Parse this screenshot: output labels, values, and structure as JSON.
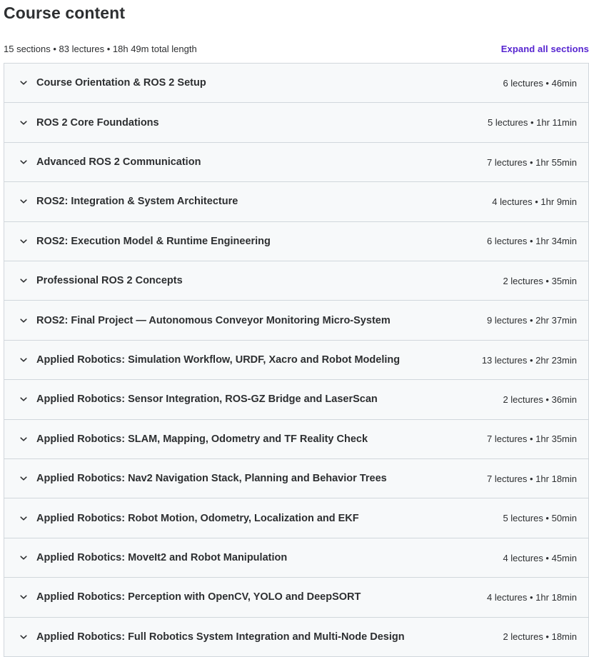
{
  "header": {
    "title": "Course content",
    "summary": "15 sections • 83 lectures • 18h 49m total length",
    "expand_label": "Expand all sections"
  },
  "colors": {
    "accent": "#5624d0",
    "text": "#2d2f31",
    "row_bg": "#f7f9fa",
    "border": "#d1d7dc"
  },
  "sections": [
    {
      "title": "Course Orientation & ROS 2 Setup",
      "meta": "6 lectures • 46min",
      "icon": "chevron-down-icon"
    },
    {
      "title": "ROS 2 Core Foundations",
      "meta": "5 lectures • 1hr 11min",
      "icon": "chevron-down-icon"
    },
    {
      "title": "Advanced ROS 2 Communication",
      "meta": "7 lectures • 1hr 55min",
      "icon": "chevron-down-icon"
    },
    {
      "title": "ROS2: Integration & System Architecture",
      "meta": "4 lectures • 1hr 9min",
      "icon": "chevron-down-icon"
    },
    {
      "title": "ROS2: Execution Model & Runtime Engineering",
      "meta": "6 lectures • 1hr 34min",
      "icon": "chevron-down-icon"
    },
    {
      "title": "Professional ROS 2 Concepts",
      "meta": "2 lectures • 35min",
      "icon": "chevron-down-icon"
    },
    {
      "title": "ROS2: Final Project — Autonomous Conveyor Monitoring Micro-System",
      "meta": "9 lectures • 2hr 37min",
      "icon": "chevron-down-icon"
    },
    {
      "title": "Applied Robotics: Simulation Workflow, URDF, Xacro and Robot Modeling",
      "meta": "13 lectures • 2hr 23min",
      "icon": "chevron-down-icon"
    },
    {
      "title": "Applied Robotics: Sensor Integration, ROS-GZ Bridge and LaserScan",
      "meta": "2 lectures • 36min",
      "icon": "chevron-down-icon"
    },
    {
      "title": "Applied Robotics: SLAM, Mapping, Odometry and TF Reality Check",
      "meta": "7 lectures • 1hr 35min",
      "icon": "chevron-down-icon"
    },
    {
      "title": "Applied Robotics: Nav2 Navigation Stack, Planning and Behavior Trees",
      "meta": "7 lectures • 1hr 18min",
      "icon": "chevron-down-icon"
    },
    {
      "title": "Applied Robotics: Robot Motion, Odometry, Localization and EKF",
      "meta": "5 lectures • 50min",
      "icon": "chevron-down-icon"
    },
    {
      "title": "Applied Robotics: MoveIt2 and Robot Manipulation",
      "meta": "4 lectures • 45min",
      "icon": "chevron-down-icon"
    },
    {
      "title": "Applied Robotics: Perception with OpenCV, YOLO and DeepSORT",
      "meta": "4 lectures • 1hr 18min",
      "icon": "chevron-down-icon"
    },
    {
      "title": "Applied Robotics: Full Robotics System Integration and Multi-Node Design",
      "meta": "2 lectures • 18min",
      "icon": "chevron-down-icon"
    }
  ]
}
